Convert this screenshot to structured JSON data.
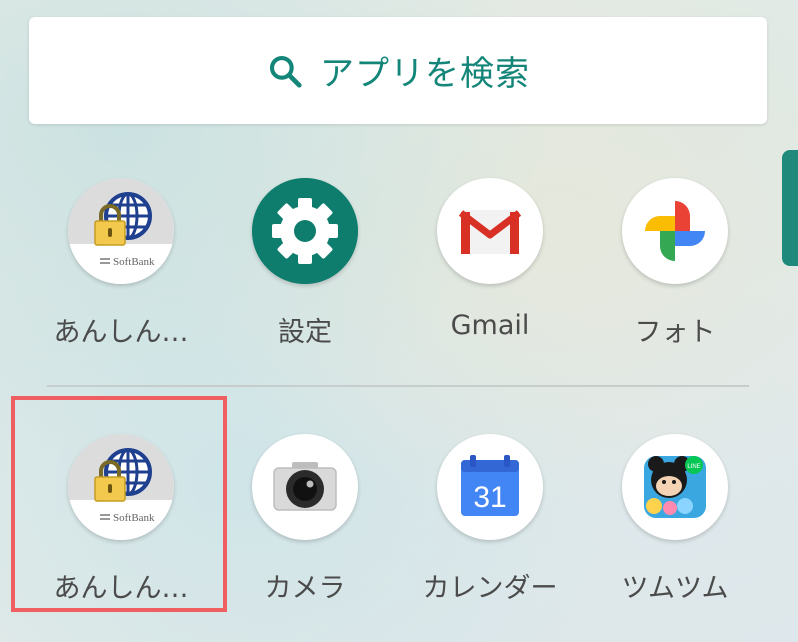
{
  "search": {
    "icon": "search-icon",
    "placeholder": "アプリを検索",
    "accent_color": "#148579"
  },
  "favorites": [
    {
      "label": "あんしん…",
      "icon": "softbank-anshin-icon"
    },
    {
      "label": "設定",
      "icon": "settings-gear-icon"
    },
    {
      "label": "Gmail",
      "icon": "gmail-icon"
    },
    {
      "label": "フォト",
      "icon": "photos-pinwheel-icon"
    }
  ],
  "apps": [
    {
      "label": "あんしん…",
      "icon": "softbank-anshin-icon",
      "highlighted": true,
      "brand": "SoftBank"
    },
    {
      "label": "カメラ",
      "icon": "camera-icon"
    },
    {
      "label": "カレンダー",
      "icon": "calendar-icon",
      "date": "31"
    },
    {
      "label": "ツムツム",
      "icon": "tsumtsum-game-icon",
      "badge": "LINE"
    }
  ],
  "softbank": {
    "brand": "SoftBank"
  },
  "highlight_color": "#ef5f61"
}
